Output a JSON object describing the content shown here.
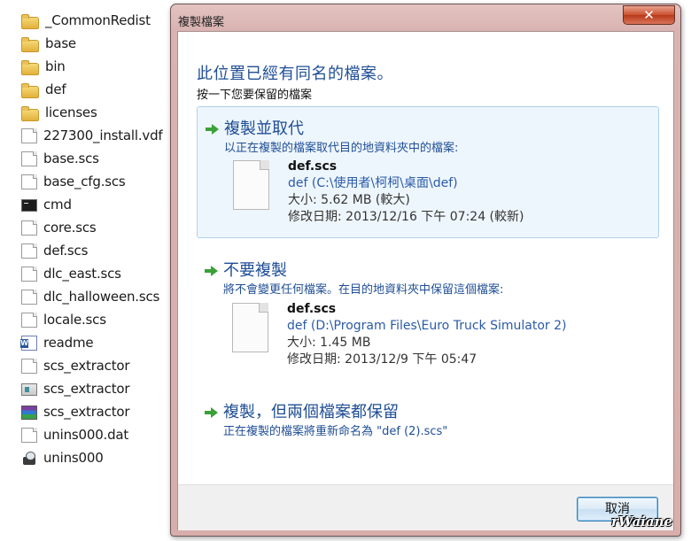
{
  "explorer": {
    "files": [
      {
        "name": "_CommonRedist",
        "icon": "folder-icon"
      },
      {
        "name": "base",
        "icon": "folder-icon"
      },
      {
        "name": "bin",
        "icon": "folder-icon"
      },
      {
        "name": "def",
        "icon": "folder-icon"
      },
      {
        "name": "licenses",
        "icon": "folder-icon"
      },
      {
        "name": "227300_install.vdf",
        "icon": "document-icon"
      },
      {
        "name": "base.scs",
        "icon": "document-icon"
      },
      {
        "name": "base_cfg.scs",
        "icon": "document-icon"
      },
      {
        "name": "cmd",
        "icon": "cmd-icon"
      },
      {
        "name": "core.scs",
        "icon": "document-icon"
      },
      {
        "name": "def.scs",
        "icon": "document-icon"
      },
      {
        "name": "dlc_east.scs",
        "icon": "document-icon"
      },
      {
        "name": "dlc_halloween.scs",
        "icon": "document-icon"
      },
      {
        "name": "locale.scs",
        "icon": "document-icon"
      },
      {
        "name": "readme",
        "icon": "word-document-icon"
      },
      {
        "name": "scs_extractor",
        "icon": "document-icon"
      },
      {
        "name": "scs_extractor",
        "icon": "application-icon"
      },
      {
        "name": "scs_extractor",
        "icon": "winrar-archive-icon"
      },
      {
        "name": "unins000.dat",
        "icon": "document-icon"
      },
      {
        "name": "unins000",
        "icon": "uninstaller-icon"
      }
    ]
  },
  "dialog": {
    "title": "複製檔案",
    "close_label": "✕",
    "heading": "此位置已經有同名的檔案。",
    "subheading": "按一下您要保留的檔案",
    "options": {
      "replace": {
        "title": "複製並取代",
        "description": "以正在複製的檔案取代目的地資料夾中的檔案:",
        "file_name": "def.scs",
        "file_path": "def (C:\\使用者\\柯柯\\桌面\\def)",
        "file_size": "大小: 5.62 MB (較大)",
        "file_modified": "修改日期: 2013/12/16 下午 07:24 (較新)"
      },
      "skip": {
        "title": "不要複製",
        "description": "將不會變更任何檔案。在目的地資料夾中保留這個檔案:",
        "file_name": "def.scs",
        "file_path": "def (D:\\Program Files\\Euro Truck Simulator 2)",
        "file_size": "大小: 1.45 MB",
        "file_modified": "修改日期: 2013/12/9 下午 05:47"
      },
      "keep_both": {
        "title": "複製，但兩個檔案都保留",
        "description": "正在複製的檔案將重新命名為 \"def (2).scs\""
      }
    },
    "cancel_label": "取消"
  },
  "watermark": "rWaiane",
  "colors": {
    "accent_blue": "#1f4e95",
    "arrow_green": "#3aa137",
    "close_red": "#c9502f",
    "selected_option_bg": "#eef6fd"
  }
}
